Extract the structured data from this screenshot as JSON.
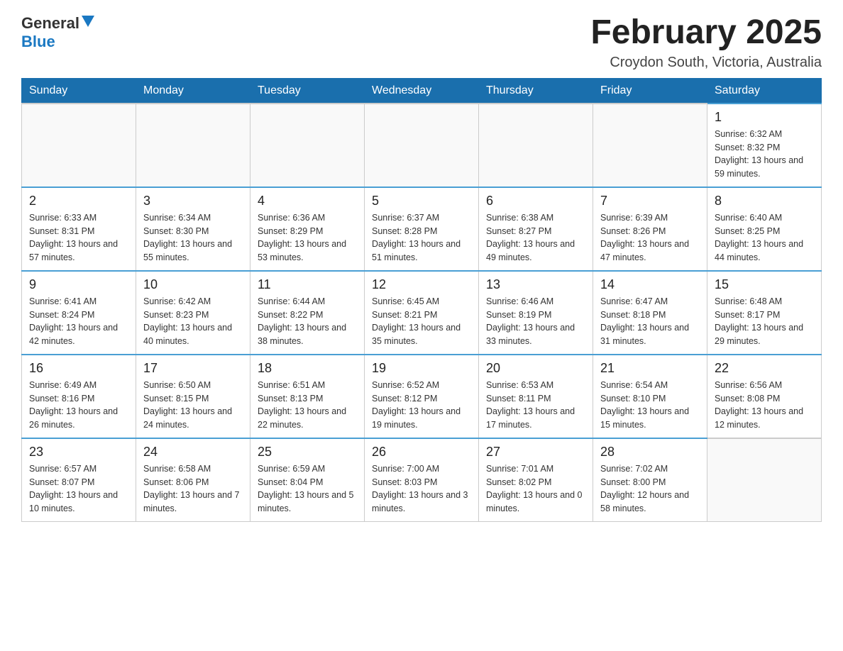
{
  "logo": {
    "general": "General",
    "blue": "Blue"
  },
  "title": "February 2025",
  "location": "Croydon South, Victoria, Australia",
  "days_of_week": [
    "Sunday",
    "Monday",
    "Tuesday",
    "Wednesday",
    "Thursday",
    "Friday",
    "Saturday"
  ],
  "weeks": [
    [
      {
        "day": "",
        "info": ""
      },
      {
        "day": "",
        "info": ""
      },
      {
        "day": "",
        "info": ""
      },
      {
        "day": "",
        "info": ""
      },
      {
        "day": "",
        "info": ""
      },
      {
        "day": "",
        "info": ""
      },
      {
        "day": "1",
        "info": "Sunrise: 6:32 AM\nSunset: 8:32 PM\nDaylight: 13 hours and 59 minutes."
      }
    ],
    [
      {
        "day": "2",
        "info": "Sunrise: 6:33 AM\nSunset: 8:31 PM\nDaylight: 13 hours and 57 minutes."
      },
      {
        "day": "3",
        "info": "Sunrise: 6:34 AM\nSunset: 8:30 PM\nDaylight: 13 hours and 55 minutes."
      },
      {
        "day": "4",
        "info": "Sunrise: 6:36 AM\nSunset: 8:29 PM\nDaylight: 13 hours and 53 minutes."
      },
      {
        "day": "5",
        "info": "Sunrise: 6:37 AM\nSunset: 8:28 PM\nDaylight: 13 hours and 51 minutes."
      },
      {
        "day": "6",
        "info": "Sunrise: 6:38 AM\nSunset: 8:27 PM\nDaylight: 13 hours and 49 minutes."
      },
      {
        "day": "7",
        "info": "Sunrise: 6:39 AM\nSunset: 8:26 PM\nDaylight: 13 hours and 47 minutes."
      },
      {
        "day": "8",
        "info": "Sunrise: 6:40 AM\nSunset: 8:25 PM\nDaylight: 13 hours and 44 minutes."
      }
    ],
    [
      {
        "day": "9",
        "info": "Sunrise: 6:41 AM\nSunset: 8:24 PM\nDaylight: 13 hours and 42 minutes."
      },
      {
        "day": "10",
        "info": "Sunrise: 6:42 AM\nSunset: 8:23 PM\nDaylight: 13 hours and 40 minutes."
      },
      {
        "day": "11",
        "info": "Sunrise: 6:44 AM\nSunset: 8:22 PM\nDaylight: 13 hours and 38 minutes."
      },
      {
        "day": "12",
        "info": "Sunrise: 6:45 AM\nSunset: 8:21 PM\nDaylight: 13 hours and 35 minutes."
      },
      {
        "day": "13",
        "info": "Sunrise: 6:46 AM\nSunset: 8:19 PM\nDaylight: 13 hours and 33 minutes."
      },
      {
        "day": "14",
        "info": "Sunrise: 6:47 AM\nSunset: 8:18 PM\nDaylight: 13 hours and 31 minutes."
      },
      {
        "day": "15",
        "info": "Sunrise: 6:48 AM\nSunset: 8:17 PM\nDaylight: 13 hours and 29 minutes."
      }
    ],
    [
      {
        "day": "16",
        "info": "Sunrise: 6:49 AM\nSunset: 8:16 PM\nDaylight: 13 hours and 26 minutes."
      },
      {
        "day": "17",
        "info": "Sunrise: 6:50 AM\nSunset: 8:15 PM\nDaylight: 13 hours and 24 minutes."
      },
      {
        "day": "18",
        "info": "Sunrise: 6:51 AM\nSunset: 8:13 PM\nDaylight: 13 hours and 22 minutes."
      },
      {
        "day": "19",
        "info": "Sunrise: 6:52 AM\nSunset: 8:12 PM\nDaylight: 13 hours and 19 minutes."
      },
      {
        "day": "20",
        "info": "Sunrise: 6:53 AM\nSunset: 8:11 PM\nDaylight: 13 hours and 17 minutes."
      },
      {
        "day": "21",
        "info": "Sunrise: 6:54 AM\nSunset: 8:10 PM\nDaylight: 13 hours and 15 minutes."
      },
      {
        "day": "22",
        "info": "Sunrise: 6:56 AM\nSunset: 8:08 PM\nDaylight: 13 hours and 12 minutes."
      }
    ],
    [
      {
        "day": "23",
        "info": "Sunrise: 6:57 AM\nSunset: 8:07 PM\nDaylight: 13 hours and 10 minutes."
      },
      {
        "day": "24",
        "info": "Sunrise: 6:58 AM\nSunset: 8:06 PM\nDaylight: 13 hours and 7 minutes."
      },
      {
        "day": "25",
        "info": "Sunrise: 6:59 AM\nSunset: 8:04 PM\nDaylight: 13 hours and 5 minutes."
      },
      {
        "day": "26",
        "info": "Sunrise: 7:00 AM\nSunset: 8:03 PM\nDaylight: 13 hours and 3 minutes."
      },
      {
        "day": "27",
        "info": "Sunrise: 7:01 AM\nSunset: 8:02 PM\nDaylight: 13 hours and 0 minutes."
      },
      {
        "day": "28",
        "info": "Sunrise: 7:02 AM\nSunset: 8:00 PM\nDaylight: 12 hours and 58 minutes."
      },
      {
        "day": "",
        "info": ""
      }
    ]
  ]
}
